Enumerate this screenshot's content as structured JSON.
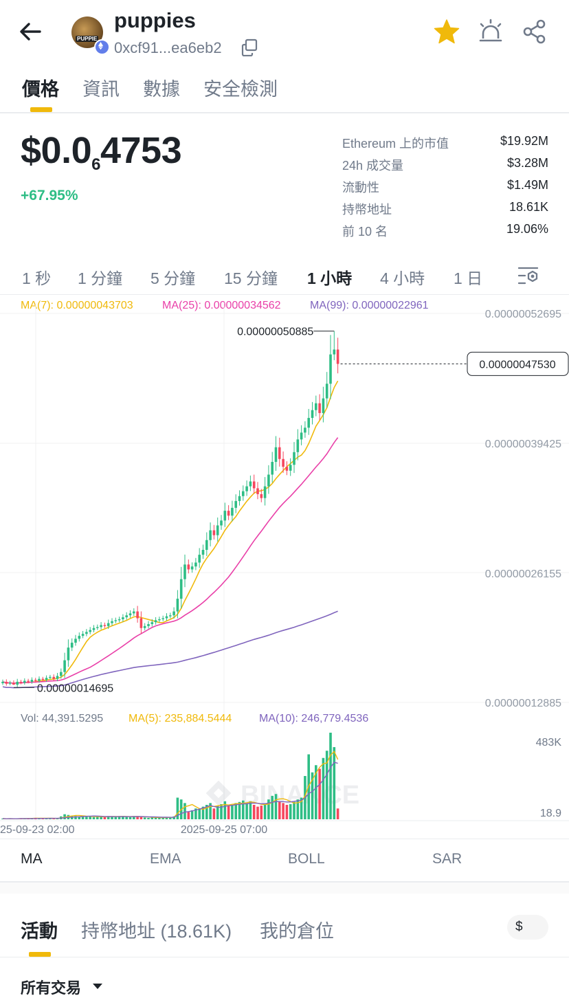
{
  "header": {
    "token_name": "puppies",
    "address": "0xcf91...ea6eb2",
    "avatar_text": "PUPPIE",
    "icons": [
      "back-arrow-icon",
      "ethereum-icon",
      "copy-icon",
      "star-icon",
      "price-alert-icon",
      "share-icon"
    ]
  },
  "tabs": [
    {
      "label": "價格",
      "active": true
    },
    {
      "label": "資訊",
      "active": false
    },
    {
      "label": "數據",
      "active": false
    },
    {
      "label": "安全檢測",
      "active": false
    }
  ],
  "price": {
    "prefix": "$0.0",
    "zero_count": "6",
    "digits": "4753",
    "change": "+67.95%"
  },
  "stats": [
    {
      "label": "Ethereum 上的市值",
      "value": "$19.92M"
    },
    {
      "label": "24h 成交量",
      "value": "$3.28M"
    },
    {
      "label": "流動性",
      "value": "$1.49M"
    },
    {
      "label": "持幣地址",
      "value": "18.61K"
    },
    {
      "label": "前 10 名",
      "value": "19.06%"
    }
  ],
  "intervals": [
    {
      "label": "1 秒",
      "active": false
    },
    {
      "label": "1 分鐘",
      "active": false
    },
    {
      "label": "5 分鐘",
      "active": false
    },
    {
      "label": "15 分鐘",
      "active": false
    },
    {
      "label": "1 小時",
      "active": true
    },
    {
      "label": "4 小時",
      "active": false
    },
    {
      "label": "1 日",
      "active": false
    }
  ],
  "ma_legend": {
    "ma7": "MA(7): 0.00000043703",
    "ma25": "MA(25): 0.00000034562",
    "ma99": "MA(99): 0.00000022961"
  },
  "vol_legend": {
    "vol": "Vol: 44,391.5295",
    "ma5": "MA(5): 235,884.5444",
    "ma10": "MA(10): 246,779.4536"
  },
  "colors": {
    "up": "#2ebd85",
    "down": "#f6465d",
    "ma7": "#f0b90b",
    "ma25": "#e93fa8",
    "ma99": "#7f64bd",
    "accent": "#f0b90b"
  },
  "chart_data": {
    "type": "candlestick",
    "interval": "1 小時",
    "watermark": "BINANCE",
    "price_axis": [
      "0.00000052695",
      "0.00000039425",
      "0.00000026155",
      "0.00000012885"
    ],
    "current_price_label": "0.00000047530",
    "high_label": "0.00000050885",
    "low_label": "0.00000014695",
    "volume_axis": [
      "483K",
      "18.9"
    ],
    "time_labels": [
      "25-09-23 02:00",
      "2025-09-25 07:00"
    ],
    "ylim": [
      1.2885e-07,
      5.2695e-07
    ],
    "current_price": 4.753e-07,
    "high": 5.0885e-07,
    "low": 1.4695e-07,
    "closes": [
      1.5e-07,
      1.48e-07,
      1.49e-07,
      1.47e-07,
      1.5e-07,
      1.49e-07,
      1.51e-07,
      1.5e-07,
      1.52e-07,
      1.51e-07,
      1.53e-07,
      1.52e-07,
      1.54e-07,
      1.55e-07,
      1.53e-07,
      1.56e-07,
      1.6e-07,
      1.72e-07,
      1.85e-07,
      1.9e-07,
      1.94e-07,
      1.97e-07,
      1.99e-07,
      2.01e-07,
      2.03e-07,
      2.05e-07,
      2.06e-07,
      2.08e-07,
      2.07e-07,
      2.1e-07,
      2.12e-07,
      2.13e-07,
      2.14e-07,
      2.16e-07,
      2.18e-07,
      2.2e-07,
      2.22e-07,
      2.15e-07,
      2.05e-07,
      2.07e-07,
      2.09e-07,
      2.11e-07,
      2.13e-07,
      2.14e-07,
      2.15e-07,
      2.17e-07,
      2.18e-07,
      2.22e-07,
      2.35e-07,
      2.55e-07,
      2.7e-07,
      2.65e-07,
      2.68e-07,
      2.72e-07,
      2.8e-07,
      2.85e-07,
      2.95e-07,
      3.05e-07,
      3e-07,
      3.1e-07,
      3.15e-07,
      3.25e-07,
      3.2e-07,
      3.28e-07,
      3.35e-07,
      3.4e-07,
      3.45e-07,
      3.5e-07,
      3.55e-07,
      3.48e-07,
      3.42e-07,
      3.38e-07,
      3.5e-07,
      3.62e-07,
      3.75e-07,
      3.9e-07,
      3.78e-07,
      3.7e-07,
      3.66e-07,
      3.72e-07,
      3.85e-07,
      3.98e-07,
      4.05e-07,
      4.1e-07,
      4.2e-07,
      4.28e-07,
      4.35e-07,
      4.25e-07,
      4.4e-07,
      4.55e-07,
      4.85e-07,
      4.9e-07,
      4.753e-07
    ],
    "volumes": [
      2,
      1,
      2,
      1,
      2,
      3,
      2,
      3,
      2,
      4,
      3,
      2,
      3,
      2,
      3,
      2,
      8,
      14,
      12,
      10,
      9,
      8,
      9,
      7,
      8,
      6,
      7,
      8,
      6,
      9,
      8,
      7,
      9,
      8,
      7,
      6,
      8,
      9,
      6,
      5,
      4,
      5,
      6,
      5,
      4,
      5,
      6,
      8,
      60,
      55,
      45,
      20,
      25,
      30,
      28,
      35,
      40,
      45,
      30,
      38,
      42,
      50,
      38,
      40,
      45,
      48,
      52,
      45,
      50,
      40,
      35,
      38,
      42,
      55,
      65,
      70,
      50,
      45,
      40,
      42,
      48,
      55,
      60,
      120,
      180,
      130,
      150,
      140,
      170,
      190,
      240,
      200,
      30
    ]
  },
  "indicators": [
    {
      "label": "MA",
      "active": true
    },
    {
      "label": "EMA",
      "active": false
    },
    {
      "label": "BOLL",
      "active": false
    },
    {
      "label": "SAR",
      "active": false
    }
  ],
  "bottom_tabs": [
    {
      "label": "活動",
      "active": true
    },
    {
      "label": "持幣地址 (18.61K)",
      "active": false
    },
    {
      "label": "我的倉位",
      "active": false
    }
  ],
  "currency_toggle": "$",
  "filter": {
    "label": "所有交易"
  }
}
